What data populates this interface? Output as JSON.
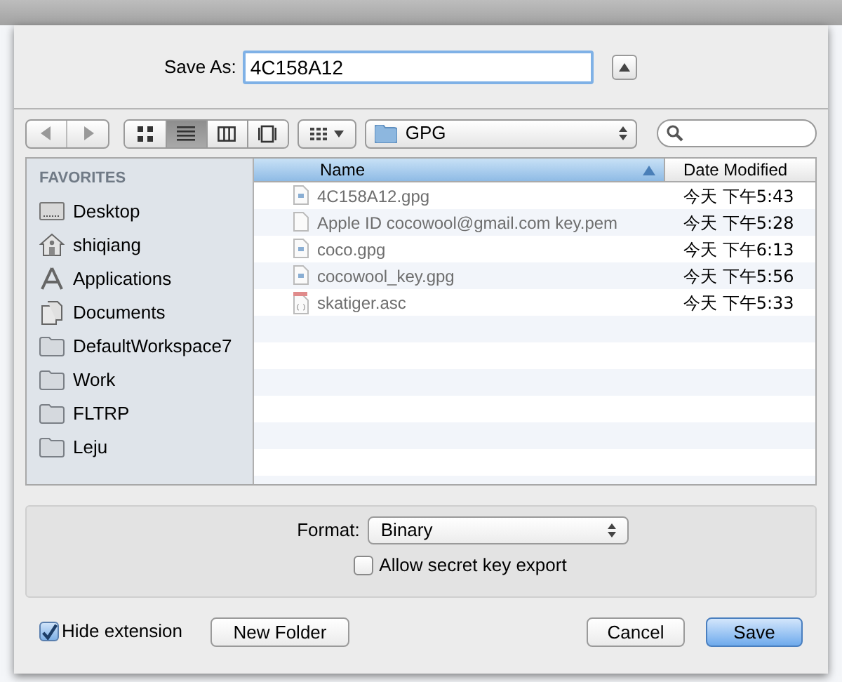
{
  "save_as": {
    "label": "Save As:",
    "value": "4C158A12",
    "expanded": false
  },
  "toolbar": {
    "view_modes": [
      {
        "kind": "icons",
        "selected": false
      },
      {
        "kind": "list",
        "selected": true
      },
      {
        "kind": "columns",
        "selected": false
      },
      {
        "kind": "coverflow",
        "selected": false
      }
    ],
    "location": "GPG"
  },
  "sidebar": {
    "heading": "FAVORITES",
    "items": [
      {
        "label": "Desktop",
        "kind": "desktop"
      },
      {
        "label": "shiqiang",
        "kind": "home"
      },
      {
        "label": "Applications",
        "kind": "apps"
      },
      {
        "label": "Documents",
        "kind": "docs"
      },
      {
        "label": "DefaultWorkspace7",
        "kind": "folder"
      },
      {
        "label": "Work",
        "kind": "folder"
      },
      {
        "label": "FLTRP",
        "kind": "folder"
      },
      {
        "label": "Leju",
        "kind": "folder"
      }
    ]
  },
  "file_list": {
    "columns": [
      {
        "label": "Name",
        "sorted": true
      },
      {
        "label": "Date Modified",
        "sorted": false
      }
    ],
    "rows": [
      {
        "name": "4C158A12.gpg",
        "date": "今天 下午5:43",
        "kind": "gpg"
      },
      {
        "name": "Apple ID cocowool@gmail.com key.pem",
        "date": "今天 下午5:28",
        "kind": "plain"
      },
      {
        "name": "coco.gpg",
        "date": "今天 下午6:13",
        "kind": "gpg"
      },
      {
        "name": "cocowool_key.gpg",
        "date": "今天 下午5:56",
        "kind": "gpg"
      },
      {
        "name": "skatiger.asc",
        "date": "今天 下午5:33",
        "kind": "asc"
      }
    ]
  },
  "options": {
    "format_label": "Format:",
    "format_value": "Binary",
    "allow_secret": {
      "label": "Allow secret key export",
      "checked": false
    }
  },
  "hide_extension": {
    "label": "Hide extension",
    "checked": true
  },
  "buttons": [
    {
      "label": "New Folder",
      "kind": "normal"
    },
    {
      "label": "Cancel",
      "kind": "normal"
    },
    {
      "label": "Save",
      "kind": "default"
    }
  ]
}
